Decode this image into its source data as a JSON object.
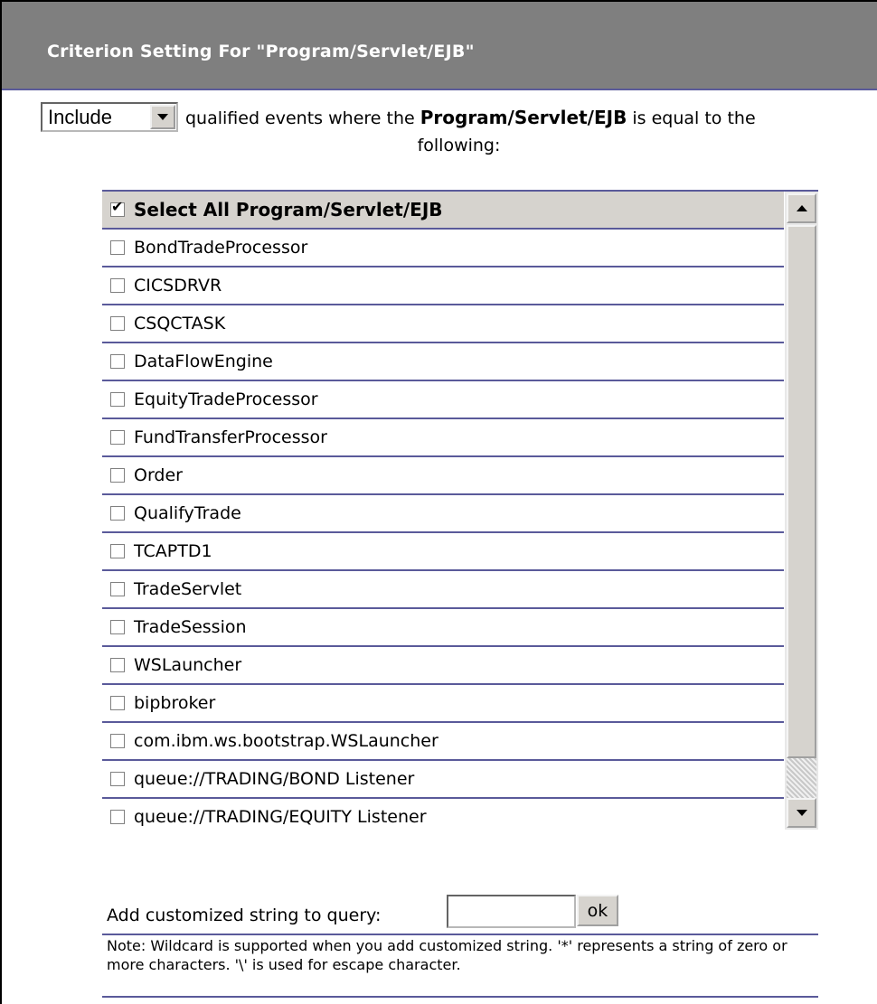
{
  "header": {
    "title": "Criterion Setting For \"Program/Servlet/EJB\""
  },
  "filter": {
    "mode_value": "Include",
    "sentence_prefix": "qualified events where the ",
    "sentence_field": "Program/Servlet/EJB",
    "sentence_suffix": " is equal to the",
    "sentence_line2": "following:"
  },
  "list": {
    "select_all_label": "Select All Program/Servlet/EJB",
    "select_all_checked": true,
    "items": [
      "BondTradeProcessor",
      "CICSDRVR",
      "CSQCTASK",
      "DataFlowEngine",
      "EquityTradeProcessor",
      "FundTransferProcessor",
      "Order",
      "QualifyTrade",
      "TCAPTD1",
      "TradeServlet",
      "TradeSession",
      "WSLauncher",
      "bipbroker",
      "com.ibm.ws.bootstrap.WSLauncher",
      "queue://TRADING/BOND Listener",
      "queue://TRADING/EQUITY Listener"
    ]
  },
  "custom": {
    "label": "Add customized string to query:",
    "input_value": "",
    "ok_label": "ok"
  },
  "note": "Note: Wildcard is supported when you add customized string. '*' represents a string of zero or more characters. '\\' is used for escape character.",
  "colors": {
    "header_bg": "#7f7f7f",
    "rule": "#5a5a9a",
    "control_face": "#d6d3ce"
  }
}
